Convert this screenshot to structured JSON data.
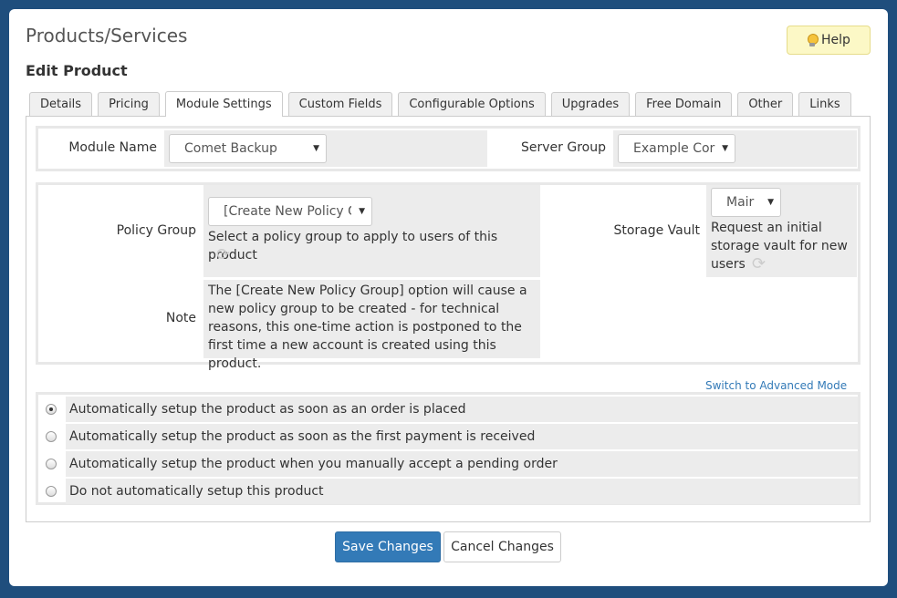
{
  "header": {
    "title": "Products/Services",
    "help_label": "Help",
    "subtitle": "Edit Product"
  },
  "tabs": [
    {
      "label": "Details",
      "active": false
    },
    {
      "label": "Pricing",
      "active": false
    },
    {
      "label": "Module Settings",
      "active": true
    },
    {
      "label": "Custom Fields",
      "active": false
    },
    {
      "label": "Configurable Options",
      "active": false
    },
    {
      "label": "Upgrades",
      "active": false
    },
    {
      "label": "Free Domain",
      "active": false
    },
    {
      "label": "Other",
      "active": false
    },
    {
      "label": "Links",
      "active": false
    }
  ],
  "module": {
    "module_name_label": "Module Name",
    "module_name_value": "Comet Backup",
    "server_group_label": "Server Group",
    "server_group_value": "Example Cor"
  },
  "settings": {
    "policy_group_label": "Policy Group",
    "policy_group_value": "[Create New Policy G",
    "policy_group_help": "Select a policy group to apply to users of this product",
    "storage_vault_label": "Storage Vault",
    "storage_vault_value": "Mair",
    "storage_vault_help": "Request an initial storage vault for new users",
    "note_label": "Note",
    "note_text": "The [Create New Policy Group] option will cause a new policy group to be created - for technical reasons, this one-time action is postponed to the first time a new account is created using this product."
  },
  "advanced_link": "Switch to Advanced Mode",
  "setup_options": [
    {
      "label": "Automatically setup the product as soon as an order is placed",
      "checked": true
    },
    {
      "label": "Automatically setup the product as soon as the first payment is received",
      "checked": false
    },
    {
      "label": "Automatically setup the product when you manually accept a pending order",
      "checked": false
    },
    {
      "label": "Do not automatically setup this product",
      "checked": false
    }
  ],
  "actions": {
    "save_label": "Save Changes",
    "cancel_label": "Cancel Changes"
  },
  "colors": {
    "background": "#1f4e7d",
    "primary": "#337ab7",
    "help_bg": "#fcf8c6"
  },
  "icons": {
    "help": "lightbulb-icon",
    "refresh": "refresh-icon",
    "dropdown": "caret-down-icon"
  }
}
